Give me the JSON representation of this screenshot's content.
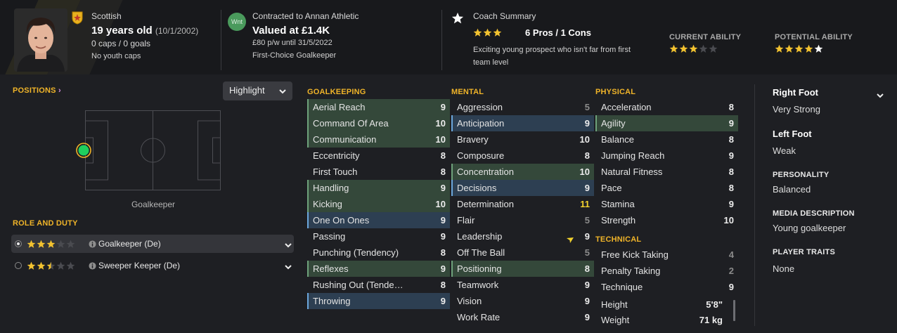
{
  "header": {
    "nationality": "Scottish",
    "age_label": "19 years old",
    "dob": "(10/1/2002)",
    "caps": "0 caps / 0 goals",
    "youth_caps": "No youth caps",
    "contract_badge": "Wnt",
    "contract_title": "Contracted to Annan Athletic",
    "value": "Valued at £1.4K",
    "wage": "£80 p/w until 31/5/2022",
    "status": "First-Choice Goalkeeper",
    "coach_title": "Coach Summary",
    "coach_stars": 3,
    "pros_cons": "6 Pros / 1 Cons",
    "coach_text_line1": "Exciting young prospect who isn't far from first",
    "coach_text_line2": "team level",
    "current_ability_label": "CURRENT ABILITY",
    "current_ability_stars": 3,
    "potential_ability_label": "POTENTIAL ABILITY",
    "potential_ability_stars": 5
  },
  "left": {
    "positions_label": "POSITIONS",
    "highlight_label": "Highlight",
    "position_name": "Goalkeeper",
    "role_duty_label": "ROLE AND DUTY",
    "roles": [
      {
        "name": "Goalkeeper (De)",
        "stars": 3,
        "selected": true
      },
      {
        "name": "Sweeper Keeper (De)",
        "stars": 2.5,
        "selected": false
      }
    ]
  },
  "columns": {
    "goalkeeping": {
      "title": "GOALKEEPING",
      "items": [
        {
          "name": "Aerial Reach",
          "value": "9",
          "hl": "green"
        },
        {
          "name": "Command Of Area",
          "value": "10",
          "hl": "green"
        },
        {
          "name": "Communication",
          "value": "10",
          "hl": "green"
        },
        {
          "name": "Eccentricity",
          "value": "8",
          "hl": ""
        },
        {
          "name": "First Touch",
          "value": "8",
          "hl": ""
        },
        {
          "name": "Handling",
          "value": "9",
          "hl": "green"
        },
        {
          "name": "Kicking",
          "value": "10",
          "hl": "green"
        },
        {
          "name": "One On Ones",
          "value": "9",
          "hl": "blue"
        },
        {
          "name": "Passing",
          "value": "9",
          "hl": ""
        },
        {
          "name": "Punching (Tendency)",
          "value": "8",
          "hl": ""
        },
        {
          "name": "Reflexes",
          "value": "9",
          "hl": "green"
        },
        {
          "name": "Rushing Out (Tende…",
          "value": "8",
          "hl": ""
        },
        {
          "name": "Throwing",
          "value": "9",
          "hl": "blue"
        }
      ]
    },
    "mental": {
      "title": "MENTAL",
      "items": [
        {
          "name": "Aggression",
          "value": "5",
          "hl": "",
          "color": "grey"
        },
        {
          "name": "Anticipation",
          "value": "9",
          "hl": "blue"
        },
        {
          "name": "Bravery",
          "value": "10",
          "hl": ""
        },
        {
          "name": "Composure",
          "value": "8",
          "hl": ""
        },
        {
          "name": "Concentration",
          "value": "10",
          "hl": "green"
        },
        {
          "name": "Decisions",
          "value": "9",
          "hl": "blue"
        },
        {
          "name": "Determination",
          "value": "11",
          "hl": "",
          "color": "yellow"
        },
        {
          "name": "Flair",
          "value": "5",
          "hl": "",
          "color": "grey"
        },
        {
          "name": "Leadership",
          "value": "9",
          "hl": "",
          "arrow": true
        },
        {
          "name": "Off The Ball",
          "value": "5",
          "hl": "",
          "color": "grey"
        },
        {
          "name": "Positioning",
          "value": "8",
          "hl": "green"
        },
        {
          "name": "Teamwork",
          "value": "9",
          "hl": ""
        },
        {
          "name": "Vision",
          "value": "9",
          "hl": ""
        },
        {
          "name": "Work Rate",
          "value": "9",
          "hl": ""
        }
      ]
    },
    "physical": {
      "title": "PHYSICAL",
      "items": [
        {
          "name": "Acceleration",
          "value": "8",
          "hl": ""
        },
        {
          "name": "Agility",
          "value": "9",
          "hl": "green"
        },
        {
          "name": "Balance",
          "value": "8",
          "hl": ""
        },
        {
          "name": "Jumping Reach",
          "value": "9",
          "hl": ""
        },
        {
          "name": "Natural Fitness",
          "value": "8",
          "hl": ""
        },
        {
          "name": "Pace",
          "value": "8",
          "hl": ""
        },
        {
          "name": "Stamina",
          "value": "9",
          "hl": ""
        },
        {
          "name": "Strength",
          "value": "10",
          "hl": ""
        }
      ]
    },
    "technical": {
      "title": "TECHNICAL",
      "items": [
        {
          "name": "Free Kick Taking",
          "value": "4",
          "hl": "",
          "color": "grey"
        },
        {
          "name": "Penalty Taking",
          "value": "2",
          "hl": "",
          "color": "grey"
        },
        {
          "name": "Technique",
          "value": "9",
          "hl": ""
        }
      ]
    },
    "body": [
      {
        "name": "Height",
        "value": "5'8\""
      },
      {
        "name": "Weight",
        "value": "71 kg"
      }
    ]
  },
  "right": {
    "right_foot_label": "Right Foot",
    "right_foot_value": "Very Strong",
    "left_foot_label": "Left Foot",
    "left_foot_value": "Weak",
    "personality_label": "PERSONALITY",
    "personality_value": "Balanced",
    "media_label": "MEDIA DESCRIPTION",
    "media_value": "Young goalkeeper",
    "traits_label": "PLAYER TRAITS",
    "traits_value": "None"
  },
  "colors": {
    "accent": "#f0b429",
    "highlight_green": "#34483a",
    "highlight_blue": "#2d3f52",
    "star": "#f2c230",
    "determination": "#f2d22e"
  }
}
